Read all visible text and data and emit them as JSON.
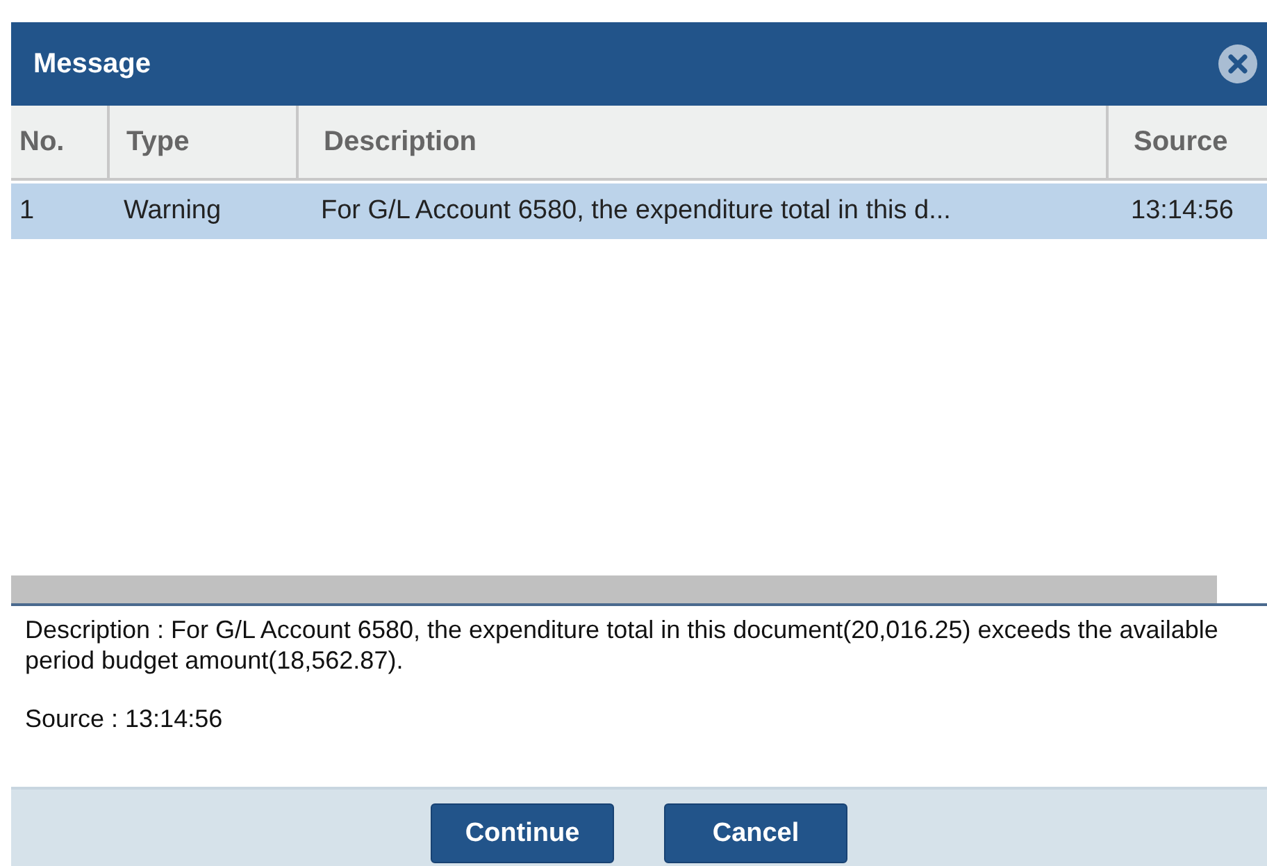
{
  "window": {
    "title": "Message"
  },
  "table": {
    "columns": [
      "No.",
      "Type",
      "Description",
      "Source"
    ],
    "rows": [
      {
        "cells": [
          "1",
          "Warning",
          "For G/L Account 6580, the expenditure total in this d...",
          "13:14:56"
        ],
        "selected": true
      }
    ]
  },
  "details": [
    "Description : For G/L Account 6580, the expenditure total in this document(20,016.25) exceeds the available period budget amount(18,562.87).",
    "Source : 13:14:56"
  ],
  "buttons": [
    "Continue",
    "Cancel"
  ]
}
